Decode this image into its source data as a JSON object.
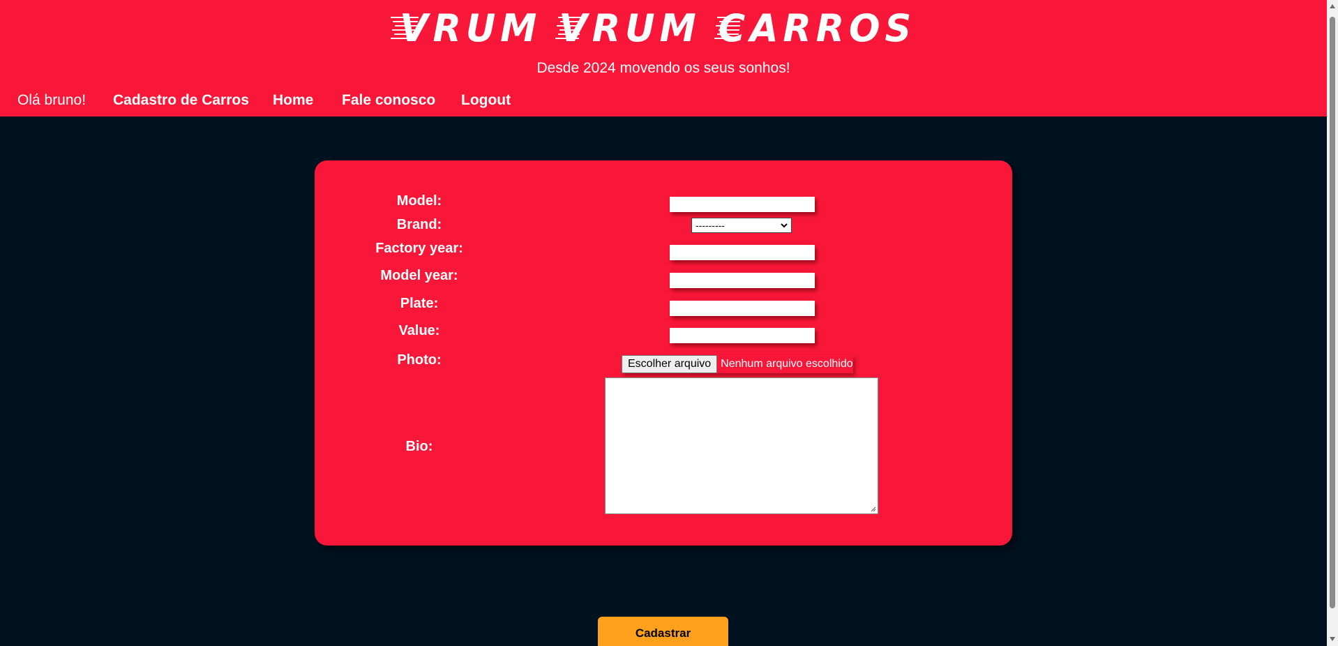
{
  "brand": {
    "logo_text": "VRUM VRUM CARROS",
    "tagline": "Desde 2024 movendo os seus sonhos!"
  },
  "nav": {
    "greeting": "Olá bruno!",
    "links": [
      "Cadastro de Carros",
      "Home",
      "Fale conosco",
      "Logout"
    ]
  },
  "form": {
    "labels": {
      "model": "Model:",
      "brand": "Brand:",
      "factory_year": "Factory year:",
      "model_year": "Model year:",
      "plate": "Plate:",
      "value": "Value:",
      "photo": "Photo:",
      "bio": "Bio:"
    },
    "values": {
      "model": "",
      "factory_year": "",
      "model_year": "",
      "plate": "",
      "value": "",
      "bio": ""
    },
    "brand_selected": "---------",
    "file_button": "Escolher arquivo",
    "file_status": "Nenhum arquivo escolhido",
    "submit": "Cadastrar"
  },
  "colors": {
    "header_bg": "#f81738",
    "page_bg": "#001220",
    "card_bg": "#f81738",
    "submit_bg": "#ffa11c"
  },
  "icons": {
    "select_arrow": "chevron-down-icon",
    "scroll_up": "triangle-up-icon",
    "scroll_down": "triangle-down-icon",
    "textarea_resize": "resize-grip-icon"
  }
}
